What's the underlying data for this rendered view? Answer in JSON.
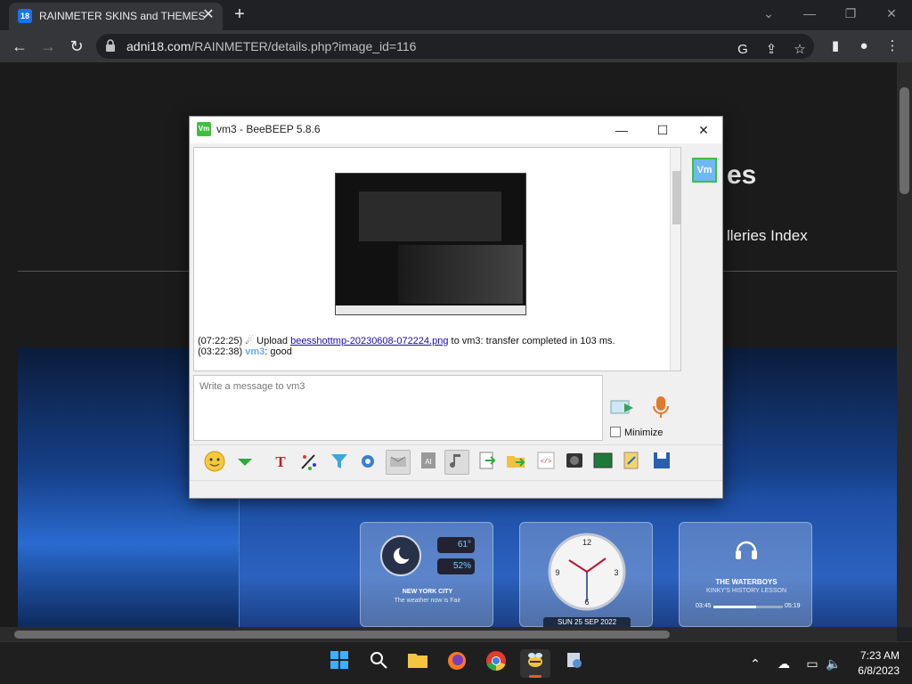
{
  "browser": {
    "tab_title": "RAINMETER SKINS and THEMES",
    "tab_favicon_text": "18",
    "close_tab": "✕",
    "new_tab": "+",
    "url_domain": "adni18.com",
    "url_path": "/RAINMETER/details.php?image_id=116",
    "window_controls": {
      "dropdown": "⌄",
      "minimize": "—",
      "restore": "❐",
      "close": "✕"
    },
    "nav": {
      "back": "←",
      "forward": "→",
      "reload": "↻"
    },
    "toolbar_icons": {
      "google": "G",
      "share": "⇪",
      "bookmark": "☆",
      "sidepanel": "▮",
      "profile": "●",
      "menu": "⋮"
    }
  },
  "page": {
    "title_partial": "es",
    "galleries_partial": "lleries Index",
    "widgets": {
      "weather_city": "NEW YORK CITY",
      "weather_text": "The weather now is Fair",
      "weather_temp": "61°",
      "weather_humidity": "52%",
      "clock_date": "SUN 25 SEP 2022",
      "music_artist": "THE WATERBOYS",
      "music_track": "KINKY'S HISTORY LESSON",
      "music_elapsed": "03:45",
      "music_total": "05:19",
      "clock_numbers": [
        "12",
        "3",
        "6",
        "9"
      ]
    }
  },
  "beebeep": {
    "title": "vm3 - BeeBEEP 5.8.6",
    "icon_text": "Vm",
    "window_controls": {
      "minimize": "—",
      "maximize": "☐",
      "close": "✕"
    },
    "messages": [
      {
        "time": "(07:22:25)",
        "pre": "Upload",
        "link": "beesshottmp-20230608-072224.png",
        "post": "to vm3: transfer completed in 103 ms."
      },
      {
        "time": "(03:22:38)",
        "user": "vm3",
        "text": ": good"
      }
    ],
    "input_placeholder": "Write a message to vm3",
    "minimize_label": "Minimize",
    "avatar_text": "Vm"
  },
  "taskbar": {
    "apps": [
      "windows-start",
      "search",
      "file-explorer",
      "firefox",
      "chrome",
      "beebeep",
      "app"
    ],
    "time": "7:23 AM",
    "date": "6/8/2023"
  }
}
